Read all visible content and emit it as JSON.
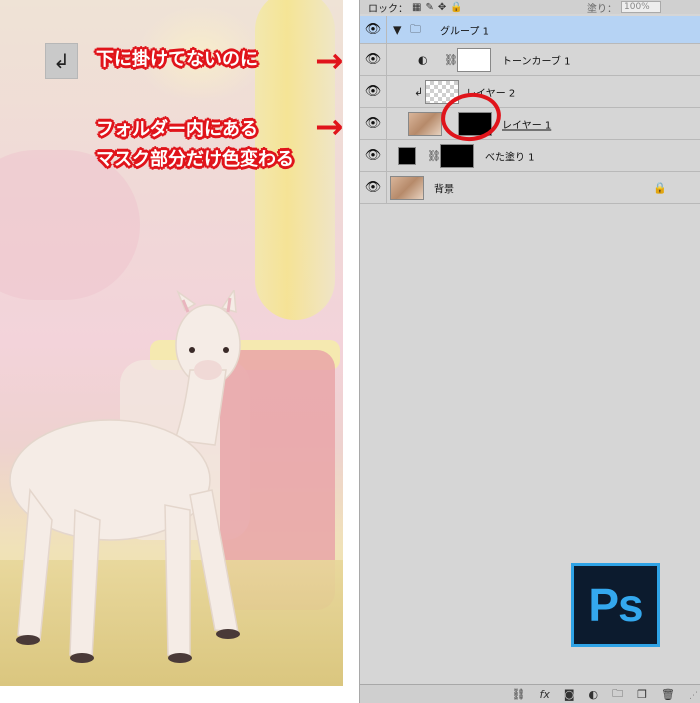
{
  "panel": {
    "lock_label": "ロック：",
    "fill_label": "塗り：",
    "fill_value": "100%"
  },
  "layers": [
    {
      "name": "グループ 1",
      "type": "group"
    },
    {
      "name": "トーンカーブ 1",
      "type": "adjustment"
    },
    {
      "name": "レイヤー 2",
      "type": "clipped"
    },
    {
      "name": "レイヤー 1",
      "type": "masked"
    },
    {
      "name": "べた塗り 1",
      "type": "fill"
    },
    {
      "name": "背景",
      "type": "background"
    }
  ],
  "canvas": {
    "clip_indicator": "↲"
  },
  "annotations": {
    "note1": "下に掛けてないのに",
    "note2": "フォルダー内にある",
    "note3": "マスク部分だけ色変わる",
    "arrow": "→"
  },
  "logo": {
    "text": "Ps"
  },
  "colors": {
    "accent_red": "#e0141b",
    "group_highlight": "#b6d3f4",
    "ps_blue": "#34a8ee"
  }
}
